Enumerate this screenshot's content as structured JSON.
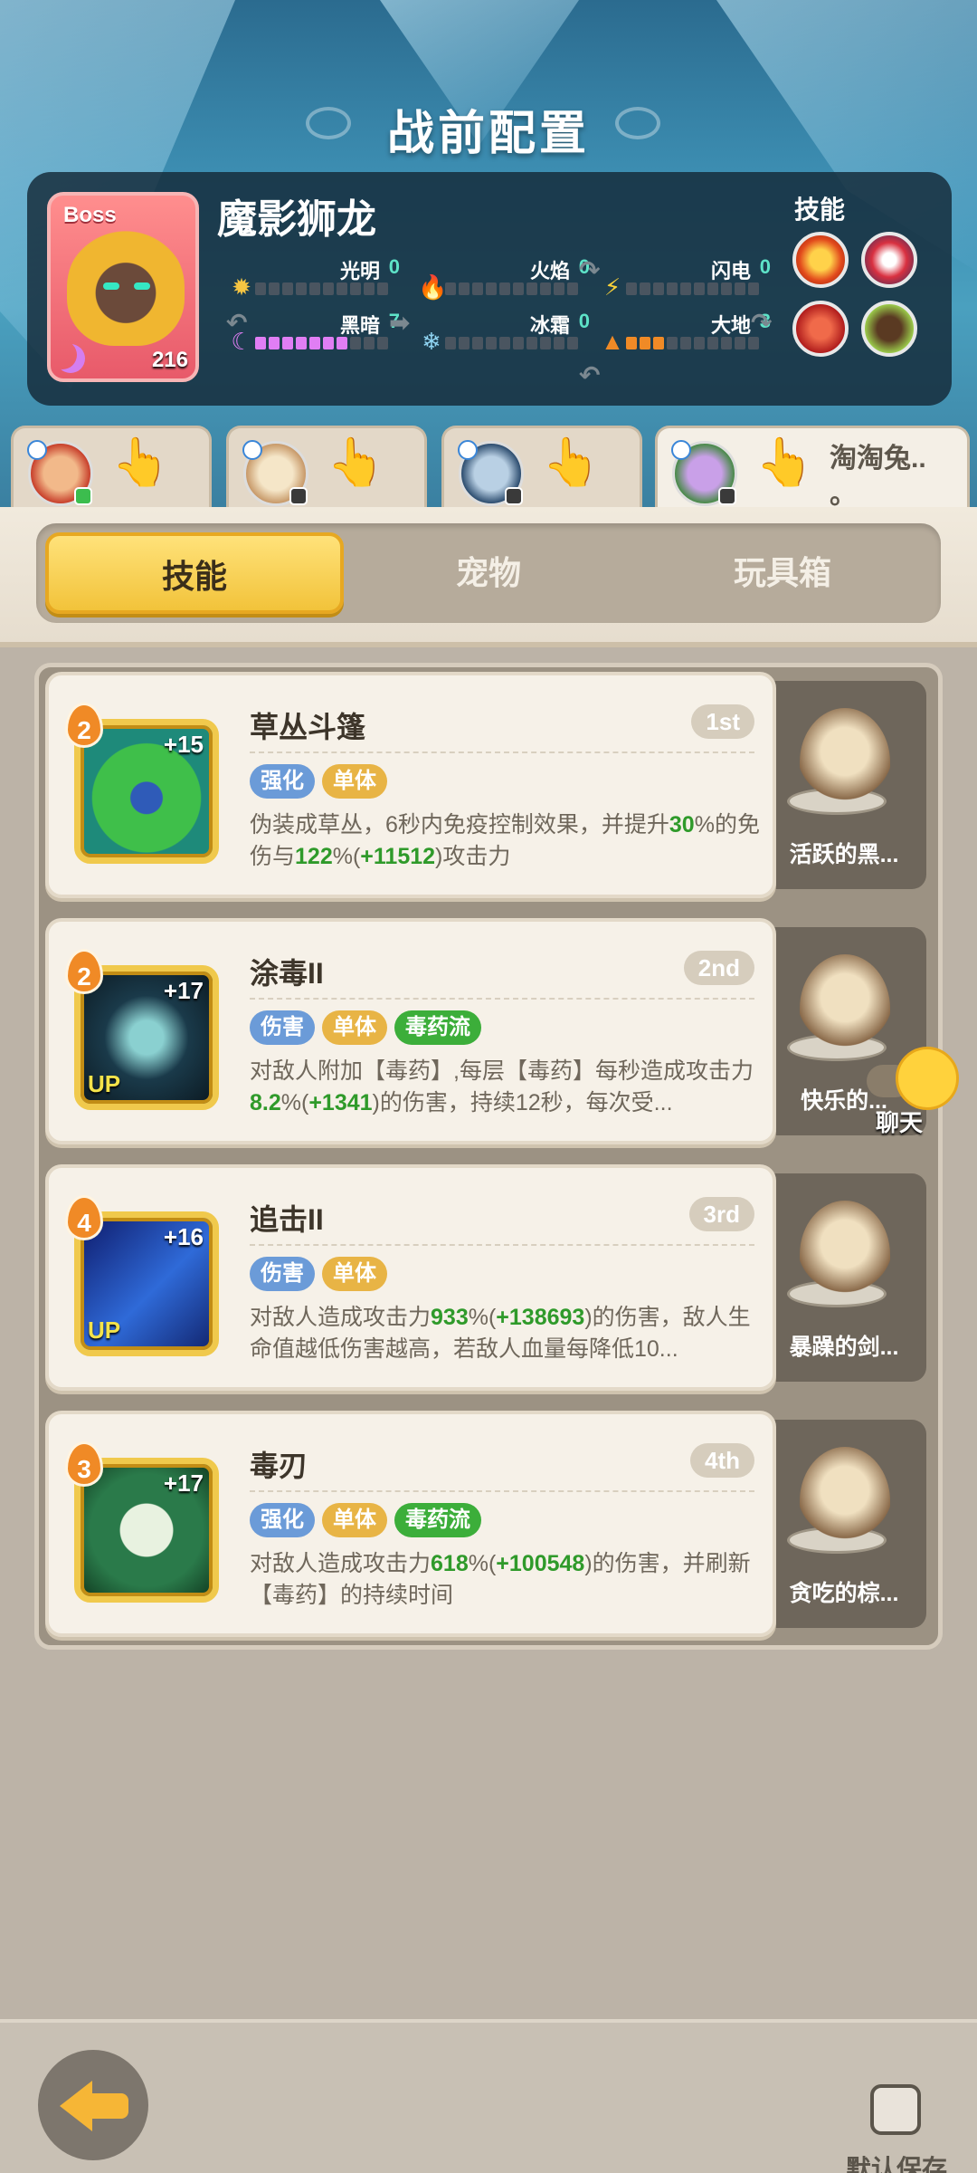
{
  "page": {
    "title": "战前配置"
  },
  "boss": {
    "tag": "Boss",
    "name": "魔影狮龙",
    "level": "216",
    "skills_label": "技能",
    "attributes": [
      {
        "label": "光明",
        "value": "0",
        "filled": 0,
        "color": "#f5c542",
        "icon": "sun-icon"
      },
      {
        "label": "火焰",
        "value": "0",
        "filled": 0,
        "color": "#e8452f",
        "icon": "fire-icon"
      },
      {
        "label": "闪电",
        "value": "0",
        "filled": 0,
        "color": "#f7d13a",
        "icon": "lightning-icon"
      },
      {
        "label": "黑暗",
        "value": "7",
        "filled": 7,
        "color": "#e07ef4",
        "icon": "moon-icon"
      },
      {
        "label": "冰霜",
        "value": "0",
        "filled": 0,
        "color": "#8fd4f2",
        "icon": "snowflake-icon"
      },
      {
        "label": "大地",
        "value": "3",
        "filled": 3,
        "color": "#f08a26",
        "icon": "mountain-icon"
      }
    ]
  },
  "team": [
    {
      "name": "",
      "active": false
    },
    {
      "name": "",
      "active": false
    },
    {
      "name": "",
      "active": false
    },
    {
      "name": "淘淘兔..\n。",
      "active": true
    }
  ],
  "tabs": [
    {
      "label": "技能",
      "active": true
    },
    {
      "label": "宠物",
      "active": false
    },
    {
      "label": "玩具箱",
      "active": false
    }
  ],
  "skills": [
    {
      "title": "草丛斗篷",
      "rank": "1st",
      "level": "2",
      "plus": "+15",
      "up": "",
      "tags": [
        {
          "text": "强化",
          "color": "#6b9bd8"
        },
        {
          "text": "单体",
          "color": "#e8b445"
        }
      ],
      "desc": [
        "伪装成草丛，6秒内免疫控制效果，并提升",
        {
          "hl": "30"
        },
        "%的免伤与",
        {
          "hl": "122"
        },
        "%(",
        {
          "hl": "+11512"
        },
        ")攻击力"
      ],
      "pet": "活跃的黑..."
    },
    {
      "title": "涂毒II",
      "rank": "2nd",
      "level": "2",
      "plus": "+17",
      "up": "UP",
      "tags": [
        {
          "text": "伤害",
          "color": "#6b9bd8"
        },
        {
          "text": "单体",
          "color": "#e8b445"
        },
        {
          "text": "毒药流",
          "color": "#3cae3a"
        }
      ],
      "desc": [
        "对敌人附加【毒药】,每层【毒药】每秒造成攻击力",
        {
          "hl": "8.2"
        },
        "%(",
        {
          "hl": "+1341"
        },
        ")的伤害，持续12秒，每次受..."
      ],
      "pet": "快乐的..."
    },
    {
      "title": "追击II",
      "rank": "3rd",
      "level": "4",
      "plus": "+16",
      "up": "UP",
      "tags": [
        {
          "text": "伤害",
          "color": "#6b9bd8"
        },
        {
          "text": "单体",
          "color": "#e8b445"
        }
      ],
      "desc": [
        "对敌人造成攻击力",
        {
          "hl": "933"
        },
        "%(",
        {
          "hl": "+138693"
        },
        ")的伤害，敌人生命值越低伤害越高，若敌人血量每降低10..."
      ],
      "pet": "暴躁的剑..."
    },
    {
      "title": "毒刃",
      "rank": "4th",
      "level": "3",
      "plus": "+17",
      "up": "",
      "tags": [
        {
          "text": "强化",
          "color": "#6b9bd8"
        },
        {
          "text": "单体",
          "color": "#e8b445"
        },
        {
          "text": "毒药流",
          "color": "#3cae3a"
        }
      ],
      "desc": [
        "对敌人造成攻击力",
        {
          "hl": "618"
        },
        "%(",
        {
          "hl": "+100548"
        },
        ")的伤害，并刷新【毒药】的持续时间"
      ],
      "pet": "贪吃的棕..."
    }
  ],
  "chat": {
    "label": "聊天"
  },
  "footer": {
    "save_label": "默认保存"
  }
}
